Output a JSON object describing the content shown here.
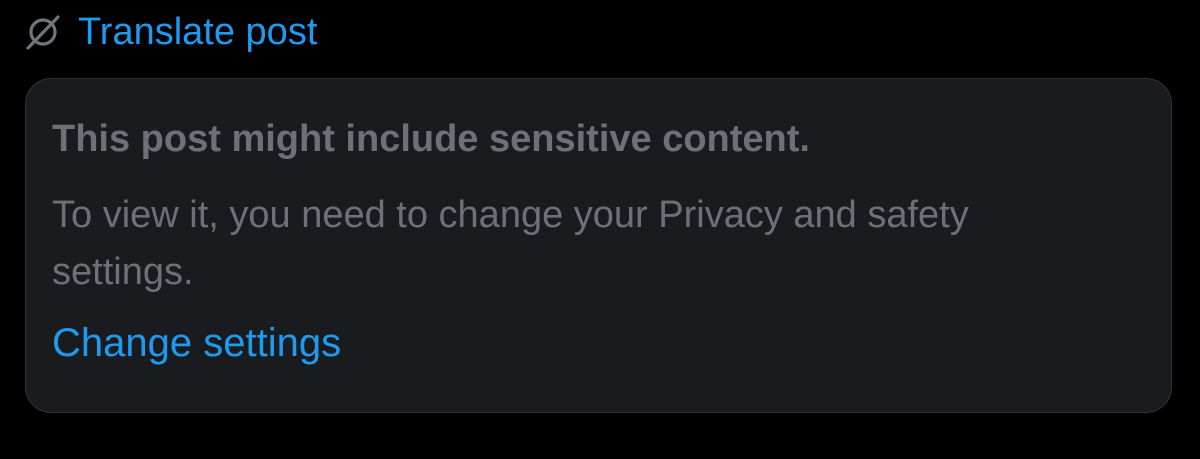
{
  "translate": {
    "icon": "translate-globe-icon",
    "label": "Translate post",
    "icon_color": "#6e767d",
    "color": "#1d9bf0"
  },
  "sensitive_warning": {
    "title": "This post might include sensitive content.",
    "body": "To view it, you need to change your Privacy and safety settings.",
    "link_label": "Change settings",
    "link_color": "#1d9bf0",
    "text_color": "#6d7176",
    "card_background": "#1a1b1f"
  }
}
